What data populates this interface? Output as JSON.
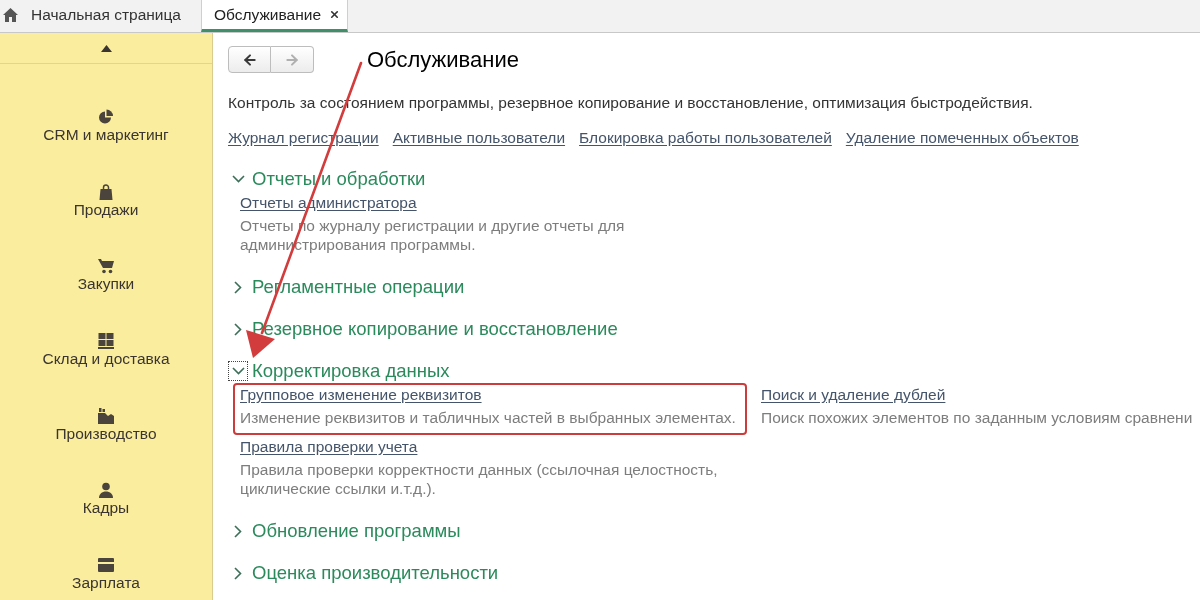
{
  "tabs": [
    {
      "kind": "home",
      "label": "Начальная страница",
      "selected": false
    },
    {
      "kind": "page",
      "label": "Обслуживание",
      "selected": true
    }
  ],
  "sidebar": {
    "items": [
      {
        "label": "CRM и маркетинг"
      },
      {
        "label": "Продажи"
      },
      {
        "label": "Закупки"
      },
      {
        "label": "Склад и доставка"
      },
      {
        "label": "Производство"
      },
      {
        "label": "Кадры"
      },
      {
        "label": "Зарплата"
      }
    ]
  },
  "navigation": [
    {
      "kind": "back",
      "disabled": false
    },
    {
      "kind": "forward",
      "disabled": true
    }
  ],
  "title": "Обслуживание",
  "description": "Контроль за состоянием программы, резервное копирование и восстановление, оптимизация быстродействия.",
  "links": [
    "Журнал регистрации",
    "Активные пользователи",
    "Блокировка работы пользователей",
    "Удаление помеченных объектов"
  ],
  "sections": [
    {
      "title": "Отчеты и обработки",
      "expanded": true,
      "focused": false,
      "columns": [
        [
          {
            "link": "Отчеты администратора",
            "description": "Отчеты по журналу регистрации и другие отчеты для администрирования программы.",
            "highlighted": false
          }
        ]
      ]
    },
    {
      "title": "Регламентные операции",
      "expanded": false,
      "focused": false
    },
    {
      "title": "Резервное копирование и восстановление",
      "expanded": false,
      "focused": false
    },
    {
      "title": "Корректировка данных",
      "expanded": true,
      "focused": true,
      "columns": [
        [
          {
            "link": "Групповое изменение реквизитов",
            "description": "Изменение реквизитов и табличных частей в выбранных элементах.",
            "highlighted": true
          },
          {
            "link": "Правила проверки учета",
            "description": "Правила проверки корректности данных (ссылочная целостность, циклические ссылки и.т.д.).",
            "highlighted": false
          }
        ],
        [
          {
            "link": "Поиск и удаление дублей",
            "description": "Поиск похожих элементов по заданным условиям сравнени",
            "highlighted": false
          }
        ]
      ]
    },
    {
      "title": "Обновление программы",
      "expanded": false,
      "focused": false
    },
    {
      "title": "Оценка производительности",
      "expanded": false,
      "focused": false
    }
  ]
}
